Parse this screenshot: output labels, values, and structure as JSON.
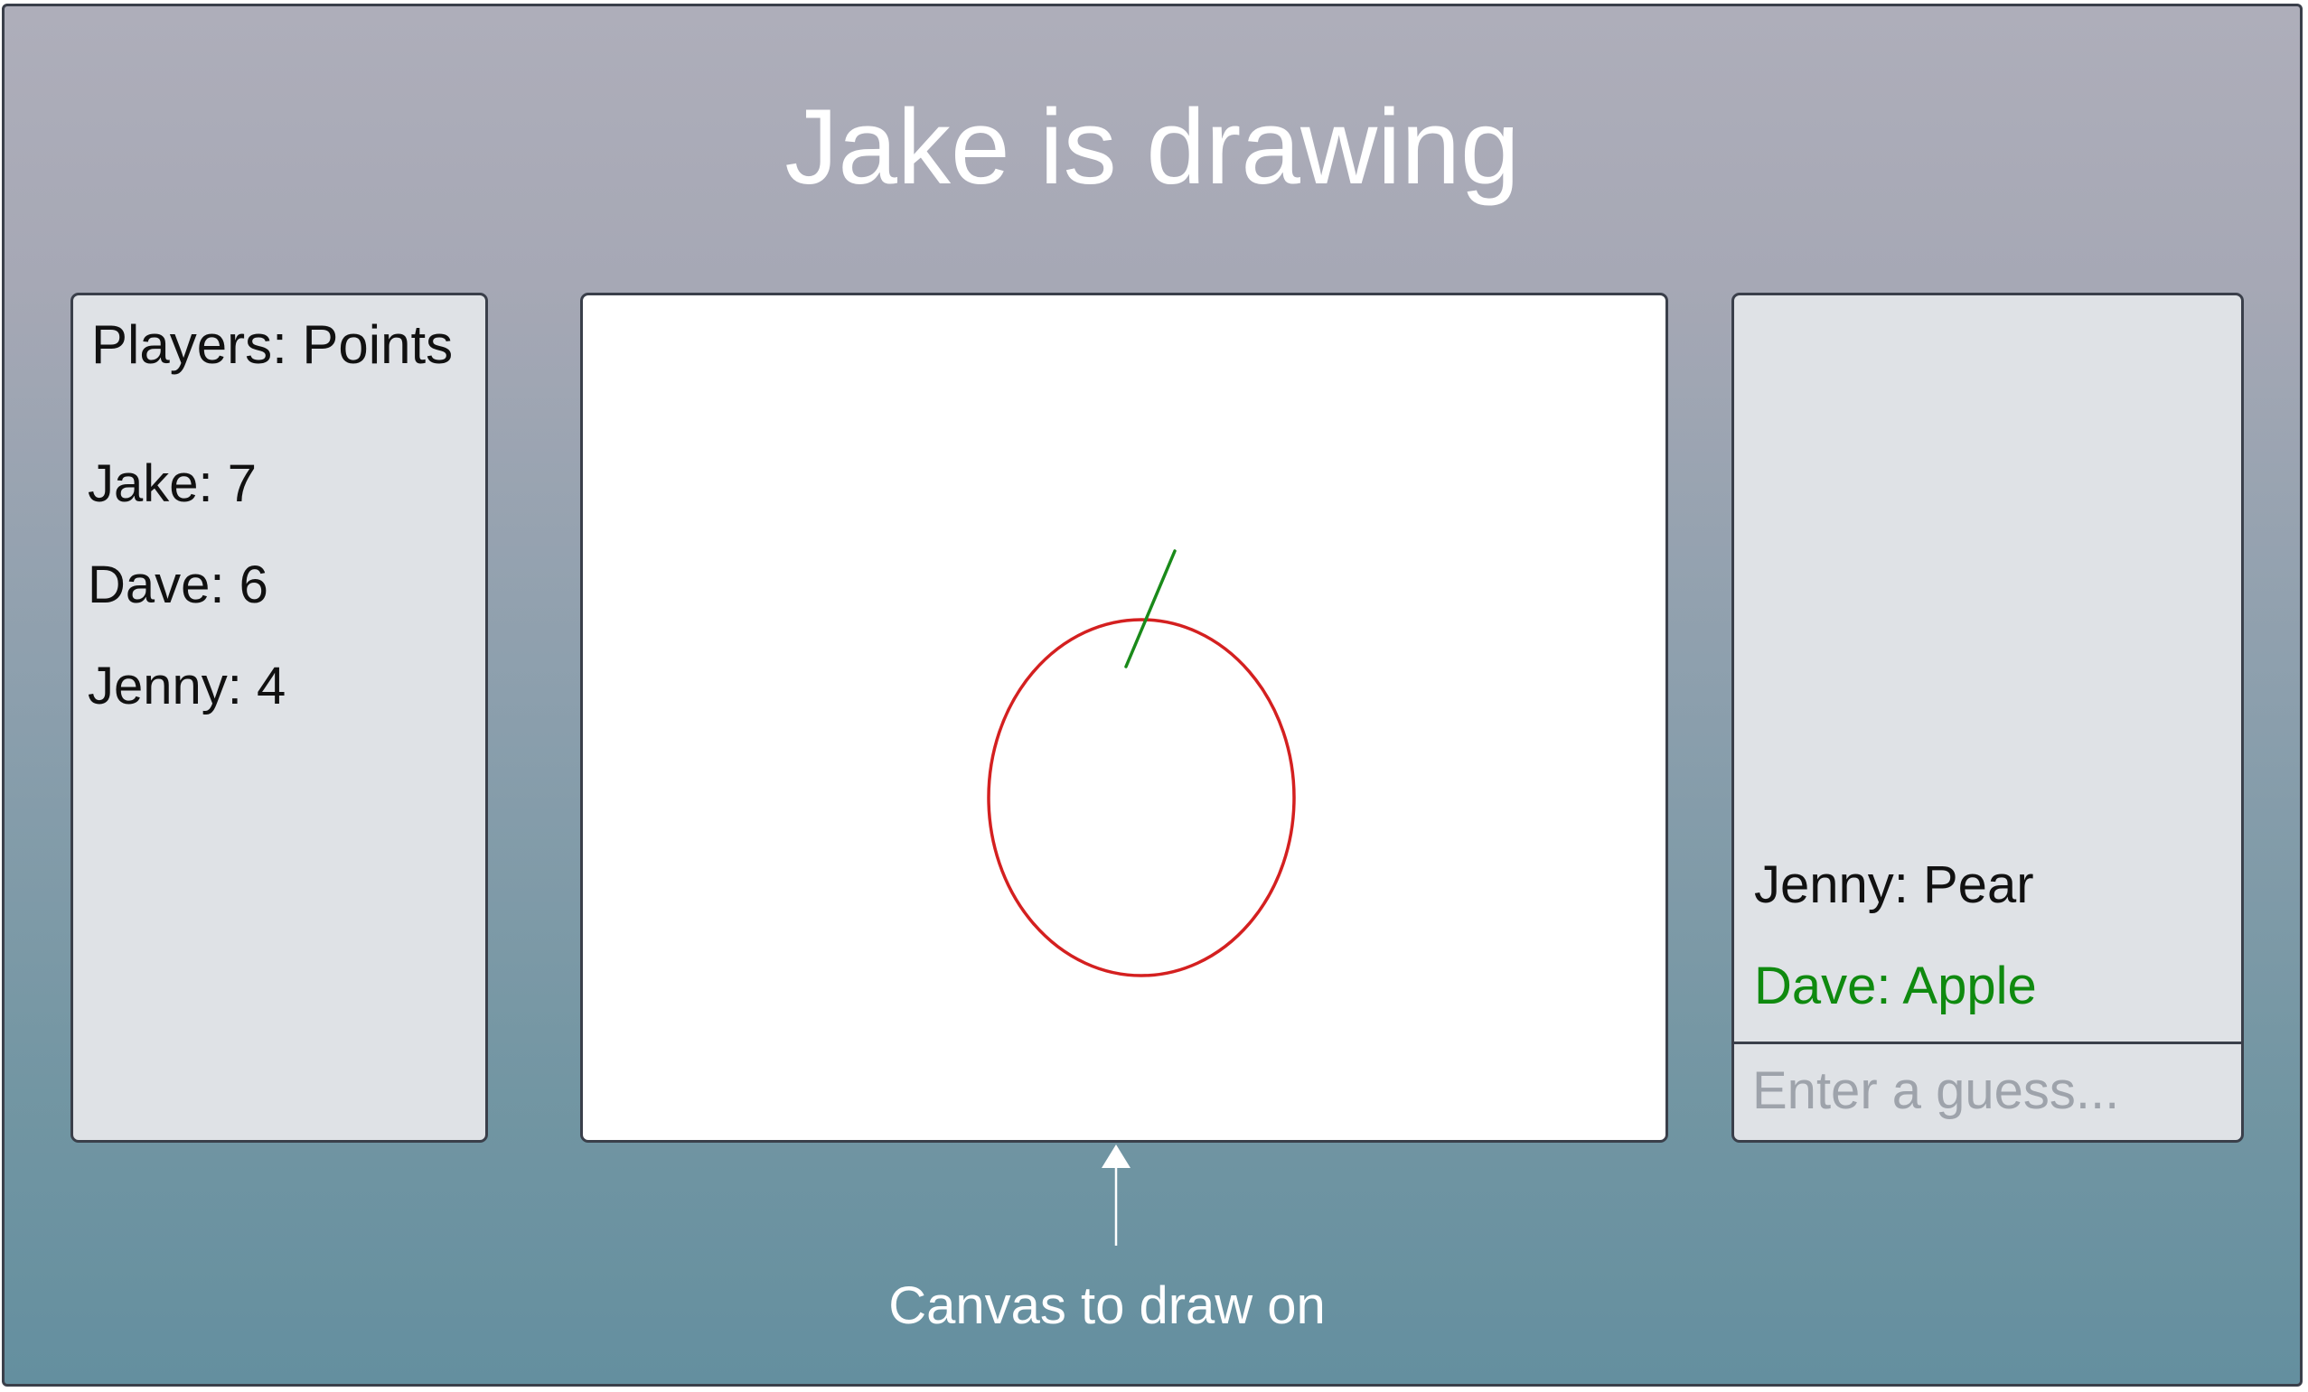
{
  "header": {
    "title": "Jake is drawing"
  },
  "players_panel": {
    "heading": "Players: Points",
    "players": [
      {
        "label": "Jake: 7"
      },
      {
        "label": "Dave: 6"
      },
      {
        "label": "Jenny: 4"
      }
    ]
  },
  "canvas": {
    "drawing": {
      "body_color": "#d42020",
      "stem_color": "#1a8a1a"
    }
  },
  "chat_panel": {
    "messages": [
      {
        "text": "Jenny: Pear",
        "color": "#111111"
      },
      {
        "text": "Dave: Apple",
        "color": "#0f8a0f"
      }
    ],
    "input": {
      "placeholder": "Enter a guess...",
      "value": ""
    }
  },
  "annotation": {
    "label": "Canvas to draw on"
  }
}
